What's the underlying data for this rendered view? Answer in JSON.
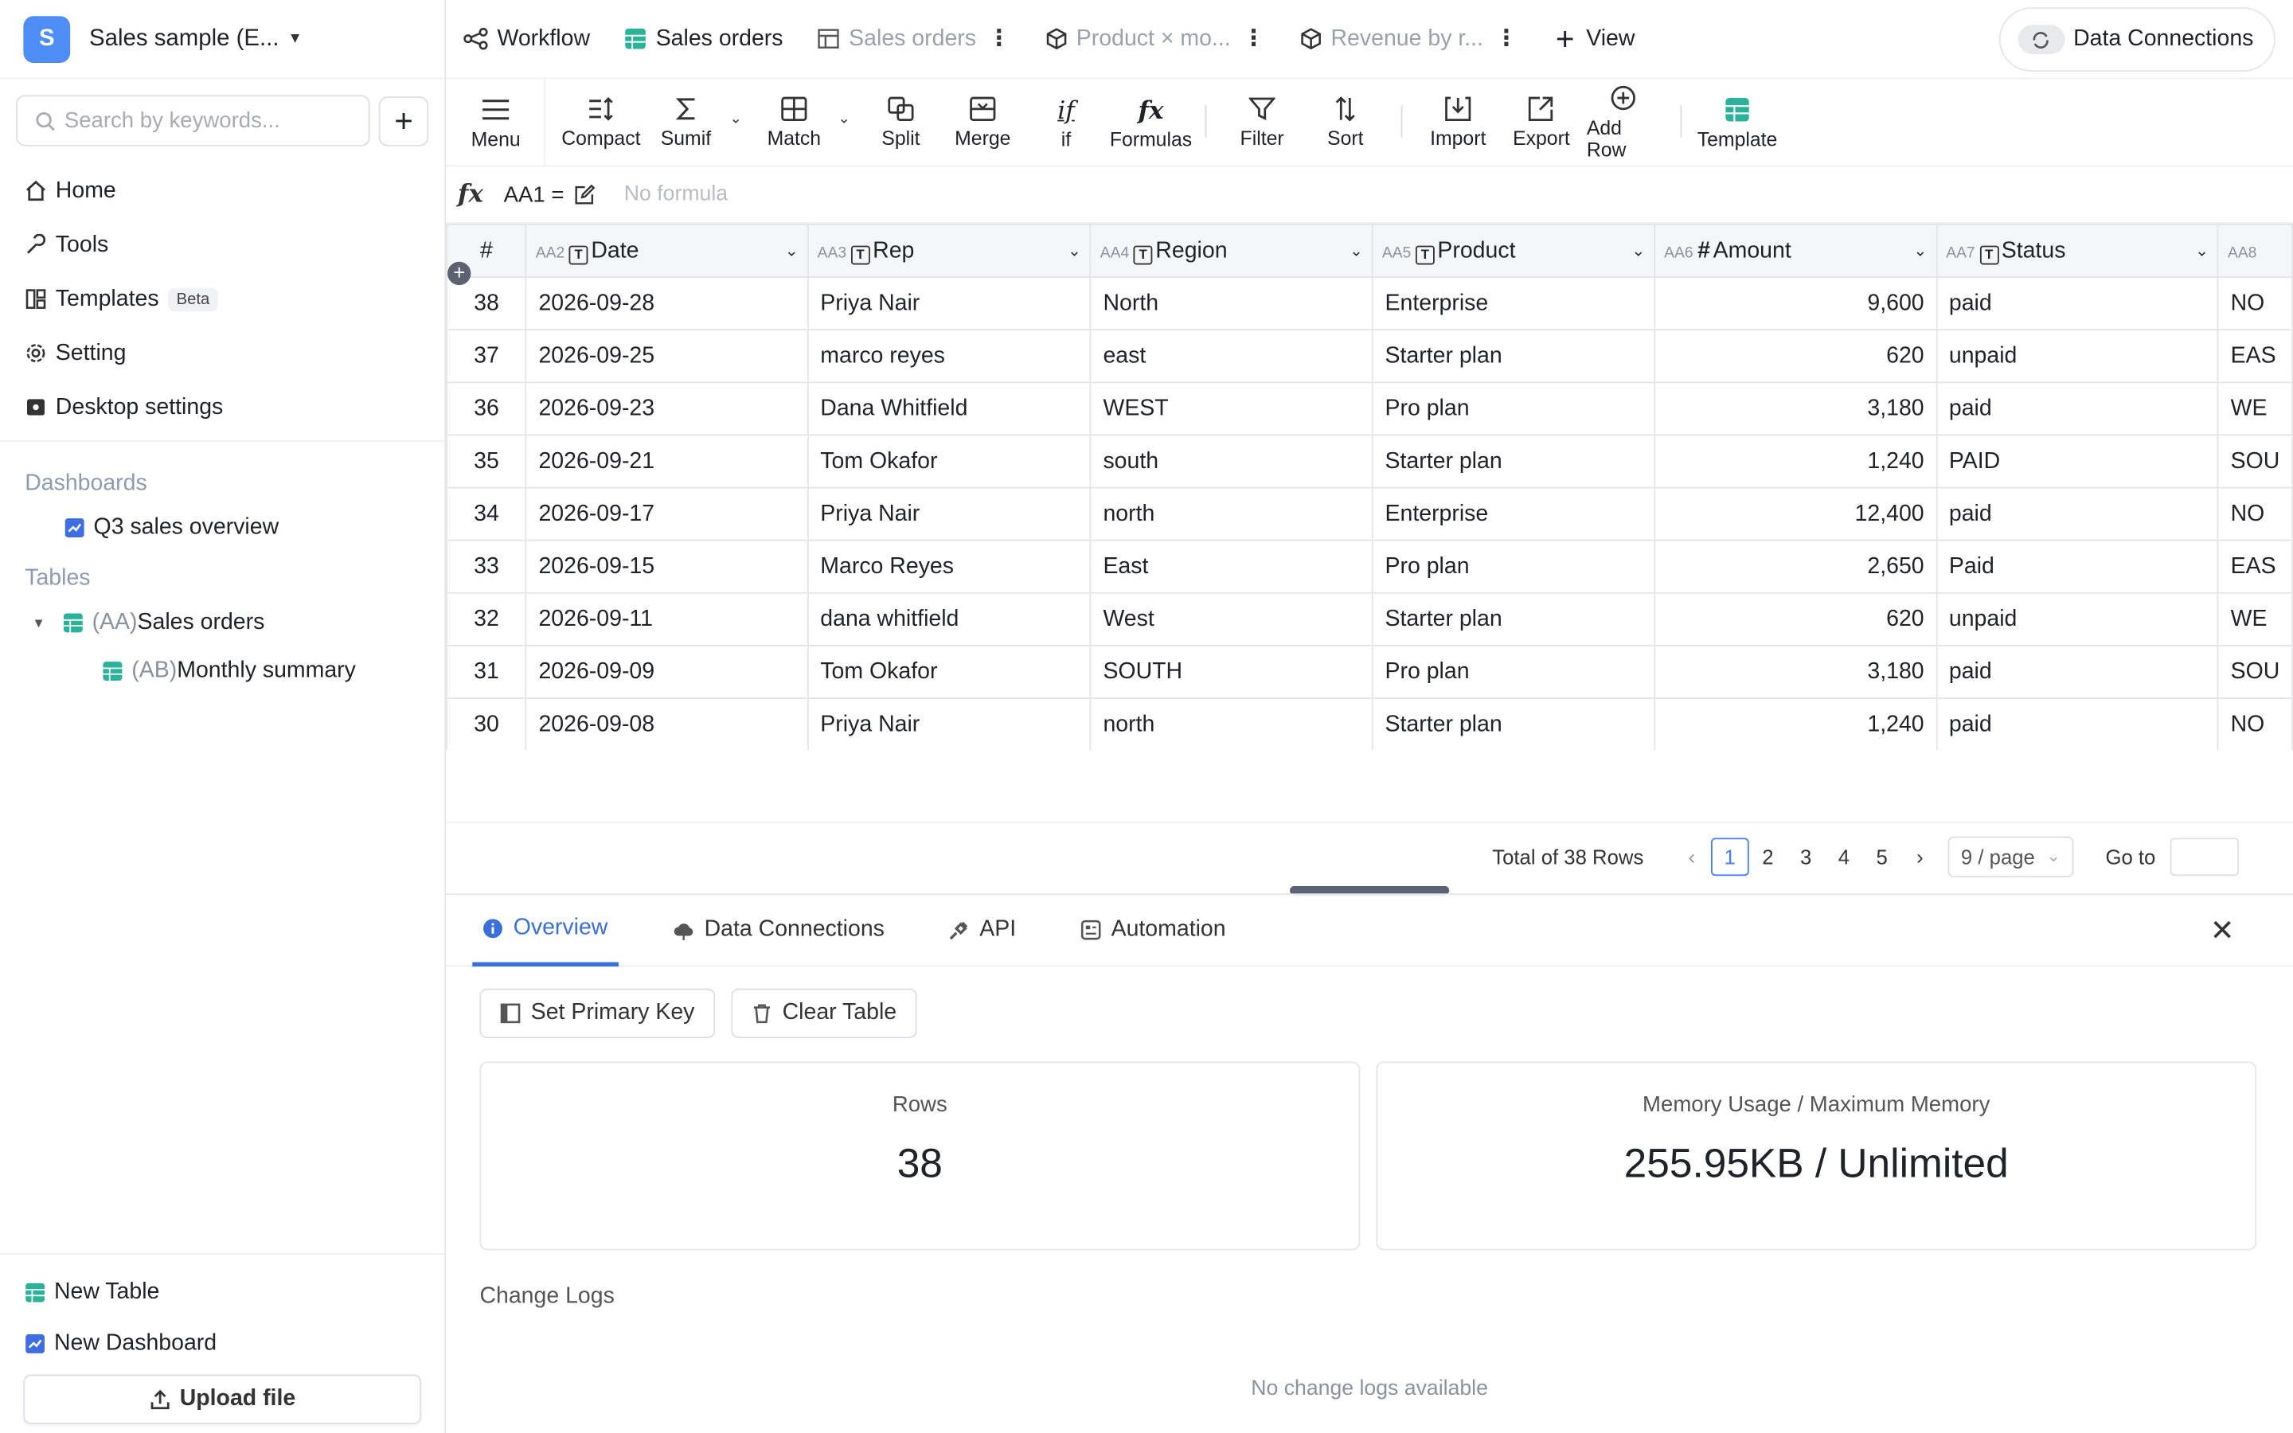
{
  "workspace": {
    "initial": "S",
    "name": "Sales sample (E..."
  },
  "search": {
    "placeholder": "Search by keywords..."
  },
  "nav": [
    {
      "label": "Home"
    },
    {
      "label": "Tools"
    },
    {
      "label": "Templates",
      "badge": "Beta"
    },
    {
      "label": "Setting"
    },
    {
      "label": "Desktop settings"
    }
  ],
  "sections": {
    "dashboards_title": "Dashboards",
    "dashboard_item": "Q3 sales overview",
    "tables_title": "Tables",
    "table_item": {
      "prefix": "(AA)",
      "name": "Sales orders"
    },
    "sub_table_item": {
      "prefix": "(AB)",
      "name": "Monthly summary"
    }
  },
  "sidebar_bottom": {
    "new_table": "New Table",
    "new_dashboard": "New Dashboard",
    "upload": "Upload file"
  },
  "view_tabs": [
    {
      "label": "Workflow"
    },
    {
      "label": "Sales orders"
    },
    {
      "label": "Sales orders"
    },
    {
      "label": "Product × mo..."
    },
    {
      "label": "Revenue by r..."
    }
  ],
  "add_view": "View",
  "data_connections_btn": "Data Connections",
  "toolbar": {
    "menu": "Menu",
    "compact": "Compact",
    "sumif": "Sumif",
    "match": "Match",
    "split": "Split",
    "merge": "Merge",
    "if": "if",
    "formulas": "Formulas",
    "filter": "Filter",
    "sort": "Sort",
    "import": "Import",
    "export": "Export",
    "add_row": "Add Row",
    "template": "Template"
  },
  "formula_bar": {
    "fx": "fx",
    "cell_ref": "AA1 =",
    "placeholder": "No formula"
  },
  "grid": {
    "row_header": "#",
    "columns": [
      {
        "id": "AA2",
        "name": "Date",
        "type": "T"
      },
      {
        "id": "AA3",
        "name": "Rep",
        "type": "T"
      },
      {
        "id": "AA4",
        "name": "Region",
        "type": "T"
      },
      {
        "id": "AA5",
        "name": "Product",
        "type": "T"
      },
      {
        "id": "AA6",
        "name": "Amount",
        "type": "#"
      },
      {
        "id": "AA7",
        "name": "Status",
        "type": "T"
      },
      {
        "id": "AA8",
        "name": "",
        "type": ""
      }
    ],
    "rows": [
      {
        "n": "38",
        "date": "2026-09-28",
        "rep": "Priya Nair",
        "region": "North",
        "product": "Enterprise",
        "amount": "9,600",
        "status": "paid",
        "extra": "NO"
      },
      {
        "n": "37",
        "date": "2026-09-25",
        "rep": "marco reyes",
        "region": "east",
        "product": "Starter plan",
        "amount": "620",
        "status": "unpaid",
        "extra": "EAS"
      },
      {
        "n": "36",
        "date": "2026-09-23",
        "rep": "Dana Whitfield",
        "region": "WEST",
        "product": "Pro plan",
        "amount": "3,180",
        "status": "paid",
        "extra": "WE"
      },
      {
        "n": "35",
        "date": "2026-09-21",
        "rep": "Tom Okafor",
        "region": "south",
        "product": "Starter plan",
        "amount": "1,240",
        "status": "PAID",
        "extra": "SOU"
      },
      {
        "n": "34",
        "date": "2026-09-17",
        "rep": "Priya Nair",
        "region": "north",
        "product": "Enterprise",
        "amount": "12,400",
        "status": "paid",
        "extra": "NO"
      },
      {
        "n": "33",
        "date": "2026-09-15",
        "rep": "Marco Reyes",
        "region": "East",
        "product": "Pro plan",
        "amount": "2,650",
        "status": "Paid",
        "extra": "EAS"
      },
      {
        "n": "32",
        "date": "2026-09-11",
        "rep": "dana whitfield",
        "region": "West",
        "product": "Starter plan",
        "amount": "620",
        "status": "unpaid",
        "extra": "WE"
      },
      {
        "n": "31",
        "date": "2026-09-09",
        "rep": "Tom Okafor",
        "region": "SOUTH",
        "product": "Pro plan",
        "amount": "3,180",
        "status": "paid",
        "extra": "SOU"
      },
      {
        "n": "30",
        "date": "2026-09-08",
        "rep": "Priya Nair",
        "region": "north",
        "product": "Starter plan",
        "amount": "1,240",
        "status": "paid",
        "extra": "NO"
      }
    ]
  },
  "pagination": {
    "total": "Total of 38 Rows",
    "pages": [
      "1",
      "2",
      "3",
      "4",
      "5"
    ],
    "current": "1",
    "per_page": "9 / page",
    "goto": "Go to"
  },
  "panel": {
    "tabs": [
      {
        "label": "Overview"
      },
      {
        "label": "Data Connections"
      },
      {
        "label": "API"
      },
      {
        "label": "Automation"
      }
    ],
    "set_primary_key": "Set Primary Key",
    "clear_table": "Clear Table",
    "rows_label": "Rows",
    "rows_value": "38",
    "memory_label": "Memory Usage / Maximum Memory",
    "memory_value": "255.95KB / Unlimited",
    "change_logs": "Change Logs",
    "no_logs": "No change logs available"
  },
  "colors": {
    "accent": "#3b6fd9",
    "avatar": "#4e8cf6",
    "table_icon": "#2bb39a",
    "dashboard_icon": "#3f6ee0"
  }
}
